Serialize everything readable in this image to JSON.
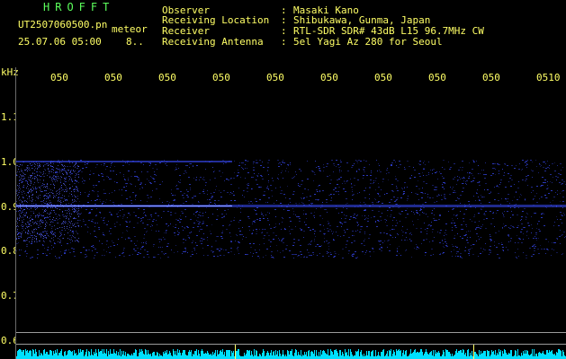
{
  "colors": {
    "title": "#5cff5c",
    "text": "#ffff66",
    "axis": "#ffff66",
    "echo": "#3a4cff",
    "power": "#00e0ff"
  },
  "header": {
    "app_title": "HROFFT",
    "file_name": "UT2507060500.pn",
    "meteor_label": "meteor",
    "date_time": "25.07.06 05:00",
    "count": "8.."
  },
  "station": {
    "rows": [
      {
        "label": "Observer",
        "value": "Masaki Kano"
      },
      {
        "label": "Receiving Location",
        "value": "Shibukawa, Gunma, Japan"
      },
      {
        "label": "Receiver",
        "value": "RTL-SDR SDR# 43dB L15 96.7MHz CW"
      },
      {
        "label": "Receiving Antenna",
        "value": "5el Yagi Az 280 for Seoul"
      }
    ],
    "separator": ":"
  },
  "axis": {
    "unit": "kHz",
    "time_ticks": [
      "050",
      "050",
      "050",
      "050",
      "050",
      "050",
      "050",
      "050",
      "050",
      "0510"
    ],
    "freq_ticks": [
      "1.1",
      "1.0",
      "0.9",
      "0.8",
      "0.7",
      "0.6"
    ]
  }
}
